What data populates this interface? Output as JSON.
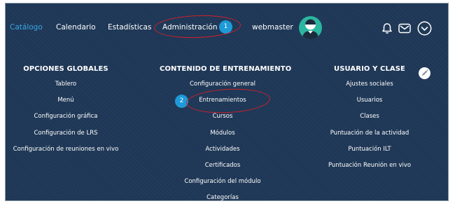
{
  "nav": {
    "items": [
      {
        "label": "Catálogo",
        "active": true
      },
      {
        "label": "Calendario",
        "active": false
      },
      {
        "label": "Estadísticas",
        "active": false
      },
      {
        "label": "Administración",
        "active": false
      }
    ],
    "user": "webmaster"
  },
  "steps": [
    "1",
    "2"
  ],
  "icons": [
    "bell-icon",
    "mail-icon",
    "chevron-down-circle-icon",
    "pencil-icon",
    "user-avatar-icon"
  ],
  "menu": {
    "global_options": {
      "title": "OPCIONES GLOBALES",
      "items": [
        "Tablero",
        "Menú",
        "Configuración gráfica",
        "Configuración de LRS",
        "Configuración de reuniones en vivo"
      ]
    },
    "training_content": {
      "title": "CONTENIDO DE ENTRENAMIENTO",
      "items": [
        "Configuración general",
        "Entrenamientos",
        "Cursos",
        "Módulos",
        "Actividades",
        "Certificados",
        "Configuración del módulo",
        "Categorías"
      ]
    },
    "user_class": {
      "title": "USUARIO Y CLASE",
      "items": [
        "Ajustes sociales",
        "Usuarios",
        "Clases",
        "Puntuación de la actividad",
        "Puntuación ILT",
        "Puntuación Reunión en vivo"
      ]
    }
  },
  "colors": {
    "background": "#1e3756",
    "accent": "#3aa5e3",
    "badge": "#1e9ad8",
    "highlight": "#d21f2a",
    "avatar": "#2bb6a0"
  }
}
